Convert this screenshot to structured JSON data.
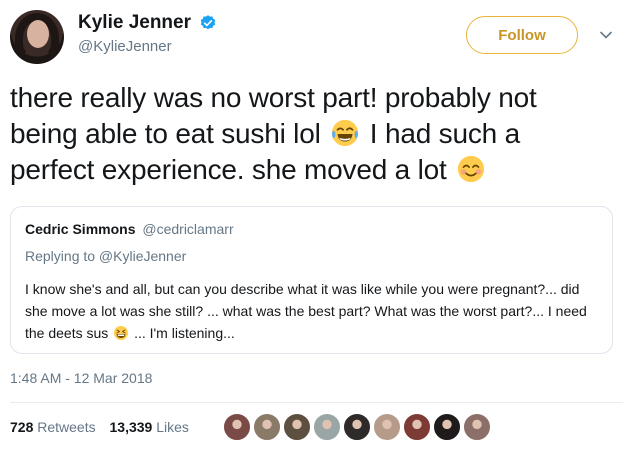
{
  "author": {
    "name": "Kylie Jenner",
    "handle": "@KylieJenner",
    "follow_label": "Follow",
    "avatar_icon": "avatar",
    "verified_icon": "verified-badge-icon"
  },
  "tweet": {
    "text_part1": "there really was no worst part! probably not being able to eat sushi lol",
    "text_part2": "I had such a perfect experience. she moved a lot",
    "emoji_1": "face-with-tears-of-joy",
    "emoji_2": "smiling-face-with-smiling-eyes"
  },
  "quoted": {
    "name": "Cedric Simmons",
    "handle": "@cedriclamarr",
    "reply_to": "Replying to @KylieJenner",
    "body_part1": "I know she's and all, but can you describe what it was like while you were pregnant?... did she move a lot was she still? ... what was the best part? What was the worst part?... I need the deets sus",
    "body_part2": "... I'm listening...",
    "emoji": "grinning-squinting-face"
  },
  "timestamp": "1:48 AM - 12 Mar 2018",
  "stats": {
    "retweets_count": "728",
    "retweets_label": "Retweets",
    "likes_count": "13,339",
    "likes_label": "Likes"
  },
  "likers": [
    {
      "color": "#7a4a46"
    },
    {
      "color": "#8a7a68"
    },
    {
      "color": "#5e5040"
    },
    {
      "color": "#9aa5a5"
    },
    {
      "color": "#2e2a2a"
    },
    {
      "color": "#b79b8a"
    },
    {
      "color": "#7d3b36"
    },
    {
      "color": "#1f1b1b"
    },
    {
      "color": "#8c6f68"
    }
  ],
  "colors": {
    "follow_accent": "#e8b43a",
    "verified_blue": "#1da1f2",
    "secondary_text": "#657786"
  }
}
